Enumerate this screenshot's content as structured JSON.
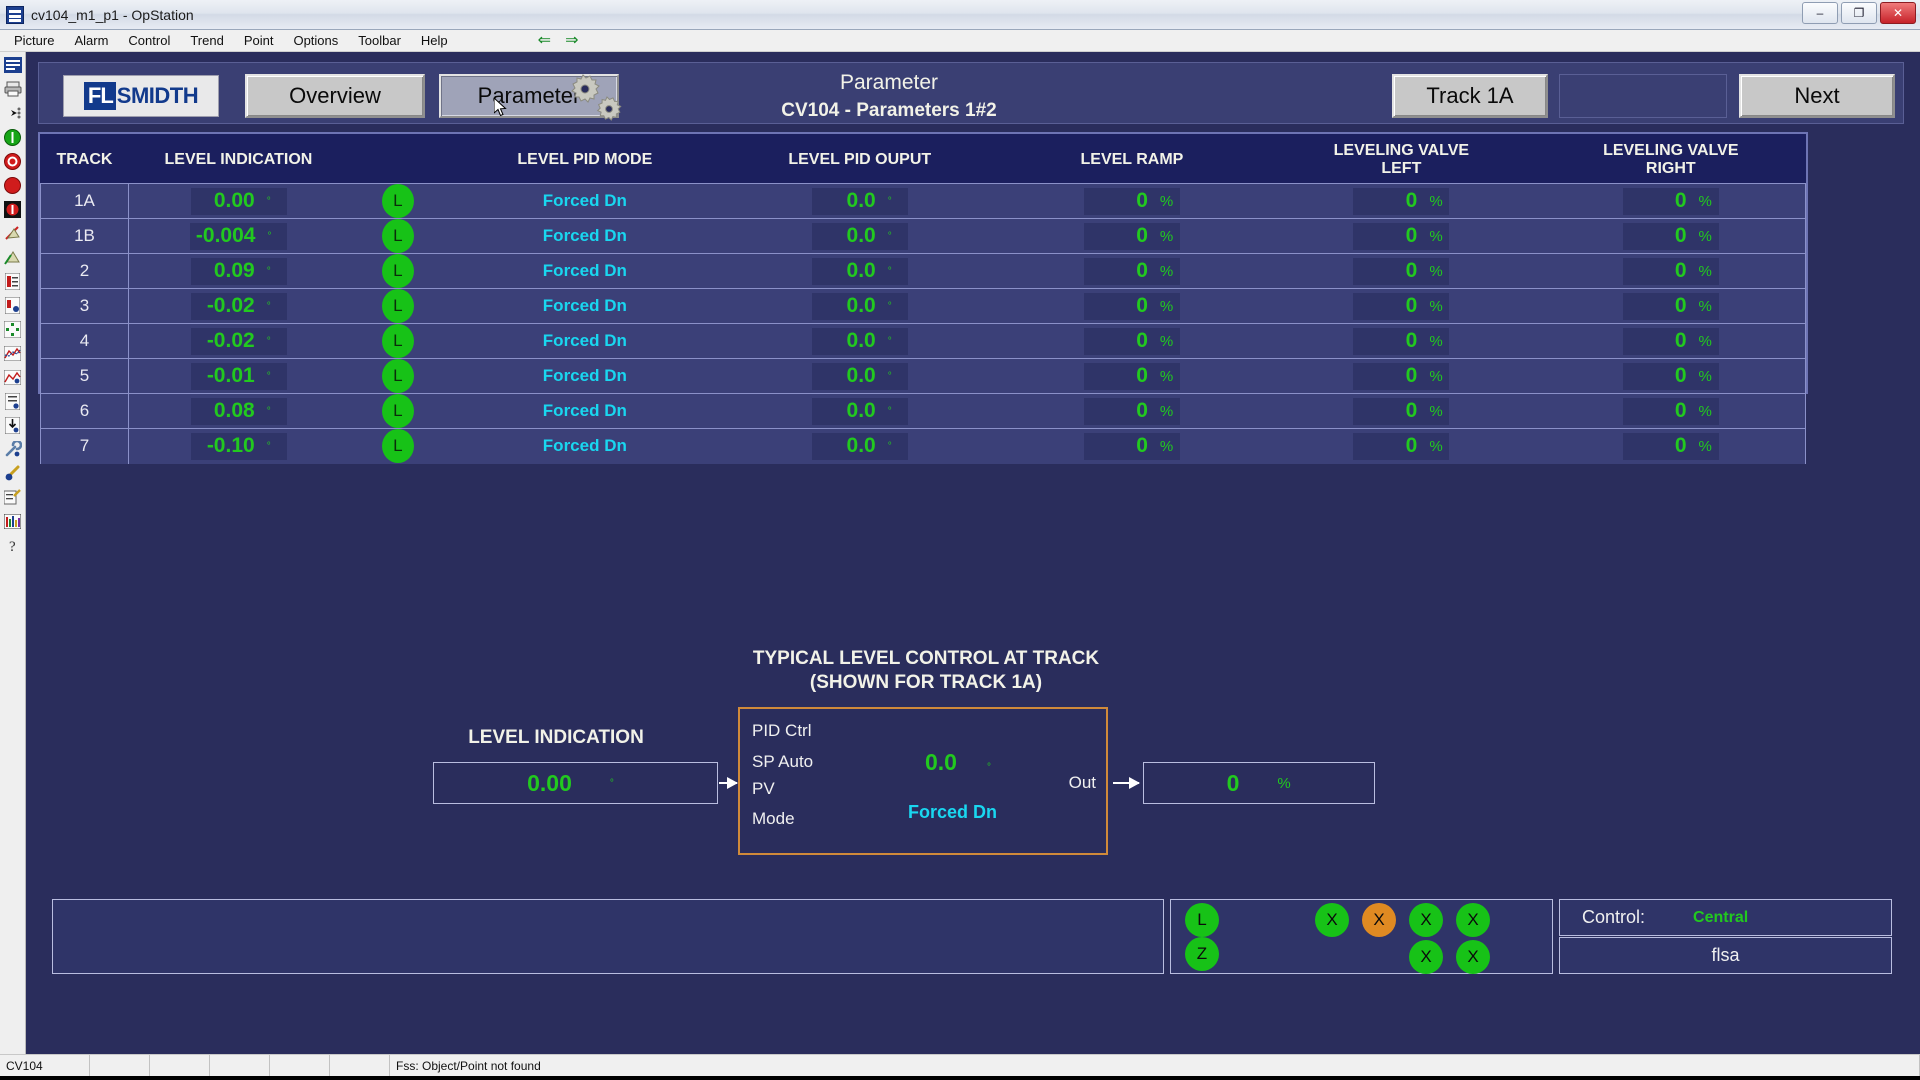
{
  "window": {
    "title": "cv104_m1_p1 - OpStation",
    "app_icon": "opstation-icon",
    "minimize": "–",
    "maximize": "❐",
    "close": "✕"
  },
  "menubar": {
    "items": [
      "Picture",
      "Alarm",
      "Control",
      "Trend",
      "Point",
      "Options",
      "Toolbar",
      "Help"
    ],
    "back_arrow": "⇐",
    "forward_arrow": "⇒"
  },
  "left_toolbar": {
    "icons": [
      "picture-icon",
      "print-icon",
      "navigate-icon",
      "alarm-acknowledge-icon",
      "alarm-stop-icon",
      "alarm-silence-icon",
      "alarm-disable-icon",
      "alarm-unack-icon",
      "alarm-bell-icon",
      "report-icon",
      "report-detail-icon",
      "point-detail-icon",
      "trend-icon",
      "trend-point-icon",
      "document-icon",
      "save-icon",
      "configure-icon",
      "pick-point-icon",
      "edit-note-icon",
      "bar-display-icon",
      "help-icon"
    ]
  },
  "header": {
    "logo_fl": "FL",
    "logo_smidth": "SMIDTH",
    "overview_label": "Overview",
    "parameter_label": "Parameter",
    "gears_icon": "gears-icon",
    "title_line1": "Parameter",
    "title_line2": "CV104 - Parameters 1#2",
    "track_label": "Track 1A",
    "blank_label": "",
    "next_label": "Next"
  },
  "table": {
    "headers": [
      "TRACK",
      "LEVEL INDICATION",
      "",
      "LEVEL PID MODE",
      "LEVEL PID OUPUT",
      "LEVEL RAMP",
      "LEVELING VALVE\nLEFT",
      "LEVELING VALVE\nRIGHT"
    ],
    "degree_unit": "°",
    "percent_unit": "%",
    "led_letter": "L",
    "rows": [
      {
        "track": "1A",
        "level_indication": "0.00",
        "led": "L",
        "pid_mode": "Forced Dn",
        "pid_output": "0.0",
        "level_ramp": "0",
        "valve_left": "0",
        "valve_right": "0"
      },
      {
        "track": "1B",
        "level_indication": "-0.004",
        "led": "L",
        "pid_mode": "Forced Dn",
        "pid_output": "0.0",
        "level_ramp": "0",
        "valve_left": "0",
        "valve_right": "0"
      },
      {
        "track": "2",
        "level_indication": "0.09",
        "led": "L",
        "pid_mode": "Forced Dn",
        "pid_output": "0.0",
        "level_ramp": "0",
        "valve_left": "0",
        "valve_right": "0"
      },
      {
        "track": "3",
        "level_indication": "-0.02",
        "led": "L",
        "pid_mode": "Forced Dn",
        "pid_output": "0.0",
        "level_ramp": "0",
        "valve_left": "0",
        "valve_right": "0"
      },
      {
        "track": "4",
        "level_indication": "-0.02",
        "led": "L",
        "pid_mode": "Forced Dn",
        "pid_output": "0.0",
        "level_ramp": "0",
        "valve_left": "0",
        "valve_right": "0"
      },
      {
        "track": "5",
        "level_indication": "-0.01",
        "led": "L",
        "pid_mode": "Forced Dn",
        "pid_output": "0.0",
        "level_ramp": "0",
        "valve_left": "0",
        "valve_right": "0"
      },
      {
        "track": "6",
        "level_indication": "0.08",
        "led": "L",
        "pid_mode": "Forced Dn",
        "pid_output": "0.0",
        "level_ramp": "0",
        "valve_left": "0",
        "valve_right": "0"
      },
      {
        "track": "7",
        "level_indication": "-0.10",
        "led": "L",
        "pid_mode": "Forced Dn",
        "pid_output": "0.0",
        "level_ramp": "0",
        "valve_left": "0",
        "valve_right": "0"
      }
    ]
  },
  "diagram": {
    "title_line1": "TYPICAL LEVEL CONTROL AT TRACK",
    "title_line2": "(SHOWN FOR TRACK 1A)",
    "level_indication_label": "LEVEL INDICATION",
    "level_indication_value": "0.00",
    "level_indication_unit": "°",
    "pid_ctrl_label": "PID Ctrl",
    "sp_auto_label": "SP Auto",
    "sp_auto_value": "0.0",
    "sp_auto_unit": "°",
    "pv_label": "PV",
    "mode_label": "Mode",
    "mode_value": "Forced Dn",
    "out_label": "Out",
    "out_value": "0",
    "out_unit": "%"
  },
  "bottom": {
    "alarm_panel": "",
    "indicators_left": [
      "L",
      "Z"
    ],
    "indicators_grid_row1": [
      "X",
      "X",
      "X",
      "X"
    ],
    "indicators_grid_row2": [
      "X",
      "X"
    ],
    "orange_indicator_index": 1,
    "control_label": "Control:",
    "control_value": "Central",
    "user": "flsa"
  },
  "statusbar": {
    "point": "CV104",
    "cell2": "",
    "cell3": "",
    "cell4": "",
    "cell5": "",
    "cell6": "",
    "message": "Fss: Object/Point not found"
  },
  "colors": {
    "value_green": "#22c91f",
    "mode_cyan": "#19d7f0",
    "pid_border_orange": "#d08a3a",
    "canvas_bg": "#2a2d5c",
    "table_bg": "#1b1f5e"
  }
}
